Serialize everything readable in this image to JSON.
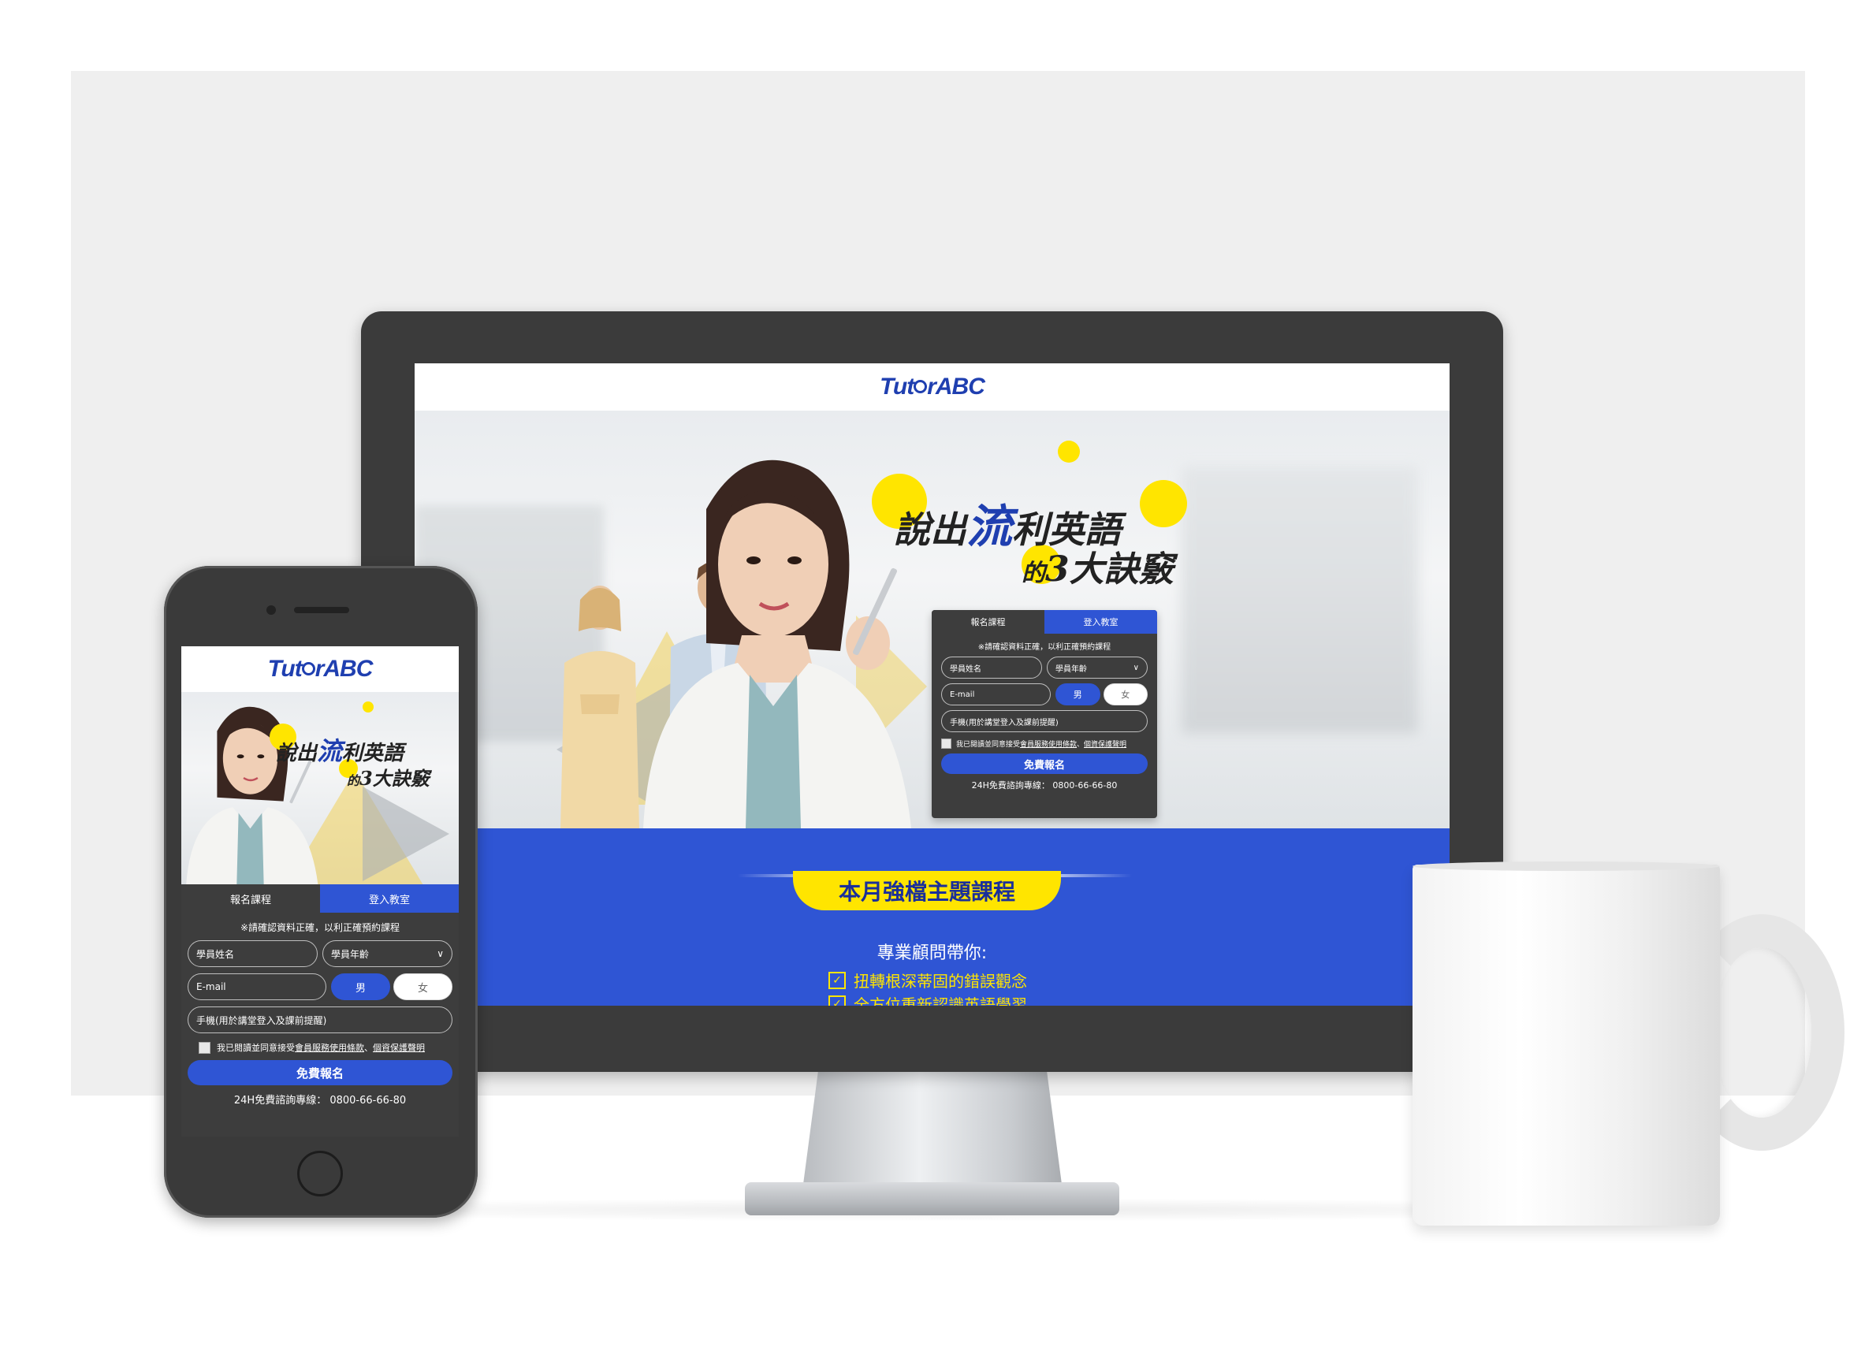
{
  "brand": {
    "logo_prefix": "Tut",
    "logo_o": "o",
    "logo_suffix": "rABC"
  },
  "hero": {
    "headline_part1": "說出",
    "headline_part2": "流",
    "headline_part3": "利英語",
    "headline_line2_a": "的",
    "headline_line2_b": "3大訣竅"
  },
  "form": {
    "tab_register": "報名課程",
    "tab_login": "登入教室",
    "note": "※請確認資料正確，以利正確預約課程",
    "name_placeholder": "學員姓名",
    "age_placeholder": "學員年齡",
    "email_placeholder": "E-mail",
    "gender_male": "男",
    "gender_female": "女",
    "phone_placeholder": "手機(用於講堂登入及課前提醒)",
    "agree_prefix": "我已閱讀並同意接受",
    "agree_terms": "會員服務使用條款",
    "agree_sep": "、",
    "agree_privacy": "個資保護聲明",
    "submit_label": "免費報名",
    "hotline": "24H免費諮詢專線： 0800-66-66-80"
  },
  "section": {
    "banner_title": "本月強檔主題課程",
    "subtitle": "專業顧問帶你:",
    "bullets": [
      "扭轉根深蒂固的錯誤觀念",
      "全方位重新認識英語學習"
    ]
  },
  "colors": {
    "brand_blue": "#2f55d4",
    "accent_yellow": "#ffe500",
    "form_dark": "#3d3d3d"
  }
}
